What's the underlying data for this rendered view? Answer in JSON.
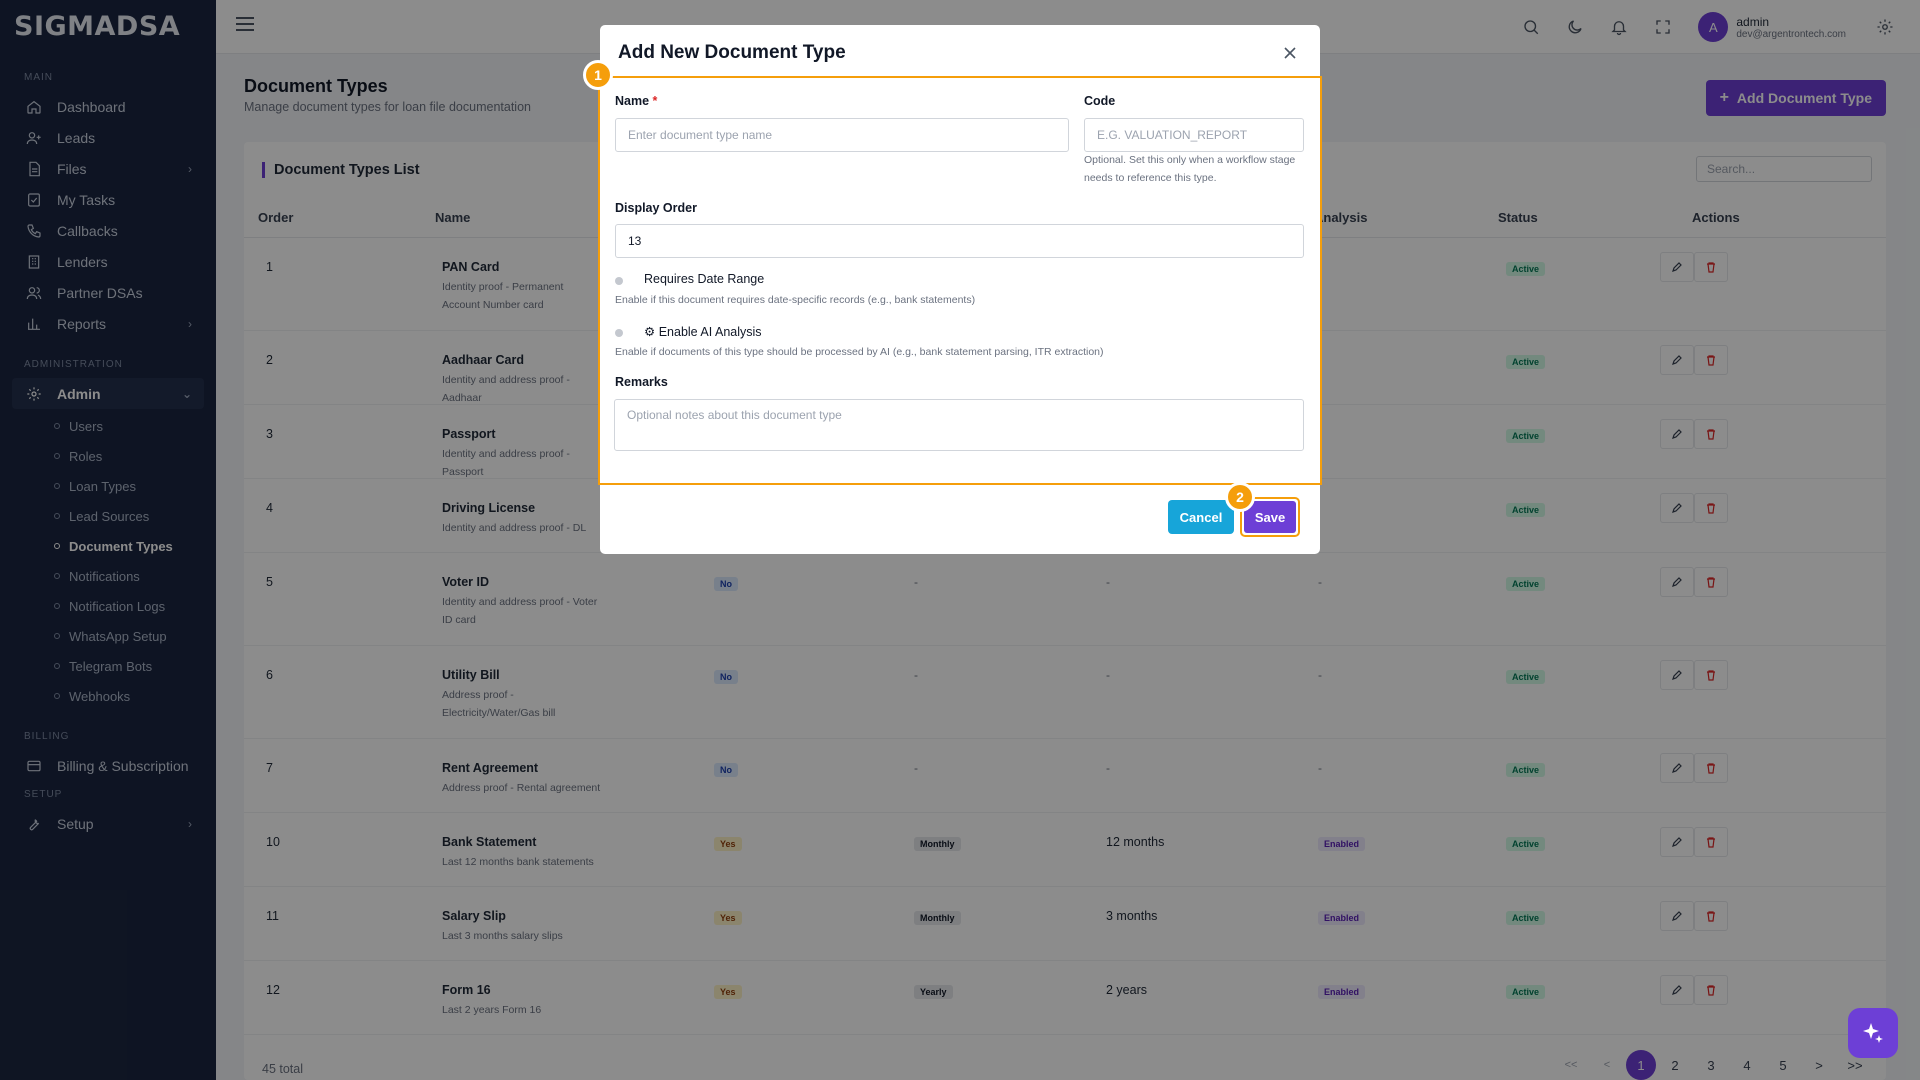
{
  "app": {
    "logo": "SIGMADSA"
  },
  "sidebar": {
    "sections": {
      "main": "MAIN",
      "administration": "ADMINISTRATION",
      "billing": "BILLING",
      "setup": "SETUP"
    },
    "main_items": [
      {
        "label": "Dashboard",
        "icon": "home-icon"
      },
      {
        "label": "Leads",
        "icon": "user-plus-icon"
      },
      {
        "label": "Files",
        "icon": "file-icon",
        "has_children": true
      },
      {
        "label": "My Tasks",
        "icon": "task-icon"
      },
      {
        "label": "Callbacks",
        "icon": "phone-icon"
      },
      {
        "label": "Lenders",
        "icon": "building-icon"
      },
      {
        "label": "Partner DSAs",
        "icon": "users-icon"
      },
      {
        "label": "Reports",
        "icon": "bar-chart-icon",
        "has_children": true
      }
    ],
    "admin": {
      "label": "Admin",
      "icon": "gear-icon"
    },
    "admin_items": [
      "Users",
      "Roles",
      "Loan Types",
      "Lead Sources",
      "Document Types",
      "Notifications",
      "Notification Logs",
      "WhatsApp Setup",
      "Telegram Bots",
      "Webhooks"
    ],
    "admin_active": "Document Types",
    "billing_item": "Billing & Subscription",
    "setup_item": "Setup"
  },
  "topbar": {
    "user": {
      "initial": "A",
      "name": "admin",
      "email": "dev@argentrontech.com"
    }
  },
  "page": {
    "title": "Document Types",
    "subtitle": "Manage document types for loan file documentation",
    "add_button": "Add Document Type",
    "list_title": "Document Types List",
    "search_placeholder": "Search...",
    "columns": {
      "order": "Order",
      "name": "Name",
      "ai": "Analysis",
      "status": "Status",
      "actions": "Actions"
    },
    "rows": [
      {
        "order": "1",
        "name": "PAN Card",
        "desc": "Identity proof - Permanent Account Number card",
        "status": "Active"
      },
      {
        "order": "2",
        "name": "Aadhaar Card",
        "desc": "Identity and address proof - Aadhaar",
        "status": "Active"
      },
      {
        "order": "3",
        "name": "Passport",
        "desc": "Identity and address proof - Passport",
        "status": "Active"
      },
      {
        "order": "4",
        "name": "Driving License",
        "desc": "Identity and address proof - DL",
        "status": "Active"
      },
      {
        "order": "5",
        "name": "Voter ID",
        "desc": "Identity and address proof - Voter ID card",
        "date_range": "No",
        "frequency": "-",
        "period": "-",
        "ai": "-",
        "status": "Active"
      },
      {
        "order": "6",
        "name": "Utility Bill",
        "desc": "Address proof - Electricity/Water/Gas bill",
        "date_range": "No",
        "frequency": "-",
        "period": "-",
        "ai": "-",
        "status": "Active"
      },
      {
        "order": "7",
        "name": "Rent Agreement",
        "desc": "Address proof - Rental agreement",
        "date_range": "No",
        "frequency": "-",
        "period": "-",
        "ai": "-",
        "status": "Active"
      },
      {
        "order": "10",
        "name": "Bank Statement",
        "desc": "Last 12 months bank statements",
        "date_range": "Yes",
        "frequency": "Monthly",
        "period": "12 months",
        "ai": "Enabled",
        "status": "Active"
      },
      {
        "order": "11",
        "name": "Salary Slip",
        "desc": "Last 3 months salary slips",
        "date_range": "Yes",
        "frequency": "Monthly",
        "period": "3 months",
        "ai": "Enabled",
        "status": "Active"
      },
      {
        "order": "12",
        "name": "Form 16",
        "desc": "Last 2 years Form 16",
        "date_range": "Yes",
        "frequency": "Yearly",
        "period": "2 years",
        "ai": "Enabled",
        "status": "Active"
      }
    ],
    "total": "45 total",
    "pager": {
      "first": "<<",
      "prev": "<",
      "pages": [
        "1",
        "2",
        "3",
        "4",
        "5"
      ],
      "current": "1",
      "next": ">",
      "last": ">>"
    }
  },
  "modal": {
    "title": "Add New Document Type",
    "steps": [
      "1",
      "2"
    ],
    "name_label": "Name",
    "name_required": "*",
    "name_placeholder": "Enter document type name",
    "code_label": "Code",
    "code_placeholder": "E.G. VALUATION_REPORT",
    "code_help": "Optional. Set this only when a workflow stage needs to reference this type.",
    "display_order_label": "Display Order",
    "display_order_value": "13",
    "date_range_label": "Requires Date Range",
    "date_range_help": "Enable if this document requires date-specific records (e.g., bank statements)",
    "ai_label": "Enable AI Analysis",
    "ai_help": "Enable if documents of this type should be processed by AI (e.g., bank statement parsing, ITR extraction)",
    "remarks_label": "Remarks",
    "remarks_placeholder": "Optional notes about this document type",
    "cancel_label": "Cancel",
    "save_label": "Save"
  },
  "colors": {
    "accent": "#6d3fd6",
    "cancel": "#17a5d9",
    "highlight": "#f59e0b",
    "sidebar": "#1b2640"
  }
}
